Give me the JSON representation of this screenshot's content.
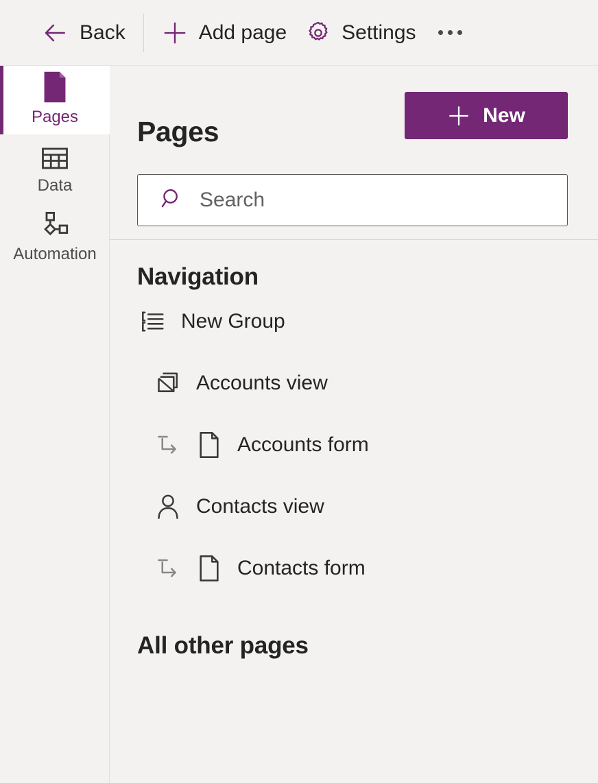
{
  "theme": {
    "accent": "#742774",
    "background": "#f3f2f1",
    "text": "#242424",
    "muted": "#616161",
    "surface": "#ffffff",
    "divider": "#d8d6d4"
  },
  "toolbar": {
    "back_label": "Back",
    "back_icon": "arrow-left-icon",
    "add_page_label": "Add page",
    "add_page_icon": "plus-icon",
    "settings_label": "Settings",
    "settings_icon": "gear-icon",
    "overflow_icon": "more-horizontal-icon"
  },
  "rail": {
    "items": [
      {
        "label": "Pages",
        "icon": "page-icon",
        "selected": true
      },
      {
        "label": "Data",
        "icon": "table-icon",
        "selected": false
      },
      {
        "label": "Automation",
        "icon": "flow-icon",
        "selected": false
      }
    ]
  },
  "panel": {
    "title": "Pages",
    "new_button_label": "New",
    "new_button_icon": "plus-icon",
    "search": {
      "placeholder": "Search",
      "value": "",
      "icon": "search-icon"
    },
    "sections": [
      {
        "heading": "Navigation",
        "items": [
          {
            "label": "New Group",
            "icon": "group-list-icon",
            "level": "group",
            "sub_arrow": false
          },
          {
            "label": "Accounts view",
            "icon": "view-icon",
            "level": "child",
            "sub_arrow": false
          },
          {
            "label": "Accounts form",
            "icon": "page-outline-icon",
            "level": "sub",
            "sub_arrow": true
          },
          {
            "label": "Contacts view",
            "icon": "person-icon",
            "level": "child",
            "sub_arrow": false
          },
          {
            "label": "Contacts form",
            "icon": "page-outline-icon",
            "level": "sub",
            "sub_arrow": true
          }
        ]
      },
      {
        "heading": "All other pages",
        "items": []
      }
    ]
  }
}
